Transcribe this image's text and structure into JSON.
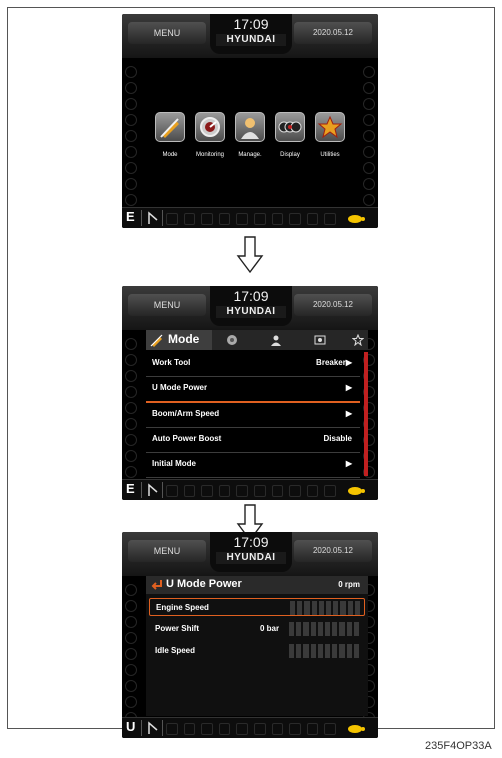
{
  "header": {
    "menu_label": "MENU",
    "time": "17:09",
    "brand": "HYUNDAI",
    "date": "2020.05.12"
  },
  "screen1": {
    "mode_letter": "E",
    "menu_items": [
      {
        "label": "Mode",
        "icon": "pencil-ruler-icon"
      },
      {
        "label": "Monitoring",
        "icon": "gauge-icon"
      },
      {
        "label": "Manage.",
        "icon": "user-icon"
      },
      {
        "label": "Display",
        "icon": "display-icon"
      },
      {
        "label": "Utilities",
        "icon": "star-icon"
      }
    ]
  },
  "screen2": {
    "mode_letter": "E",
    "tab_title": "Mode",
    "rows": [
      {
        "label": "Work Tool",
        "value": "Breaker▶"
      },
      {
        "label": "U Mode Power",
        "value": "▶"
      },
      {
        "label": "Boom/Arm Speed",
        "value": "▶"
      },
      {
        "label": "Auto Power Boost",
        "value": "Disable"
      },
      {
        "label": "Initial Mode",
        "value": "▶"
      }
    ]
  },
  "screen3": {
    "mode_letter": "U",
    "title": "U Mode Power",
    "rpm": "0 rpm",
    "rows": [
      {
        "label": "Engine Speed",
        "value": ""
      },
      {
        "label": "Power Shift",
        "value": "0 bar"
      },
      {
        "label": "Idle Speed",
        "value": ""
      }
    ]
  },
  "figure_id": "235F4OP33A",
  "colors": {
    "accent": "#e06020",
    "scroll": "#c02020",
    "turtle": "#f5c400"
  }
}
